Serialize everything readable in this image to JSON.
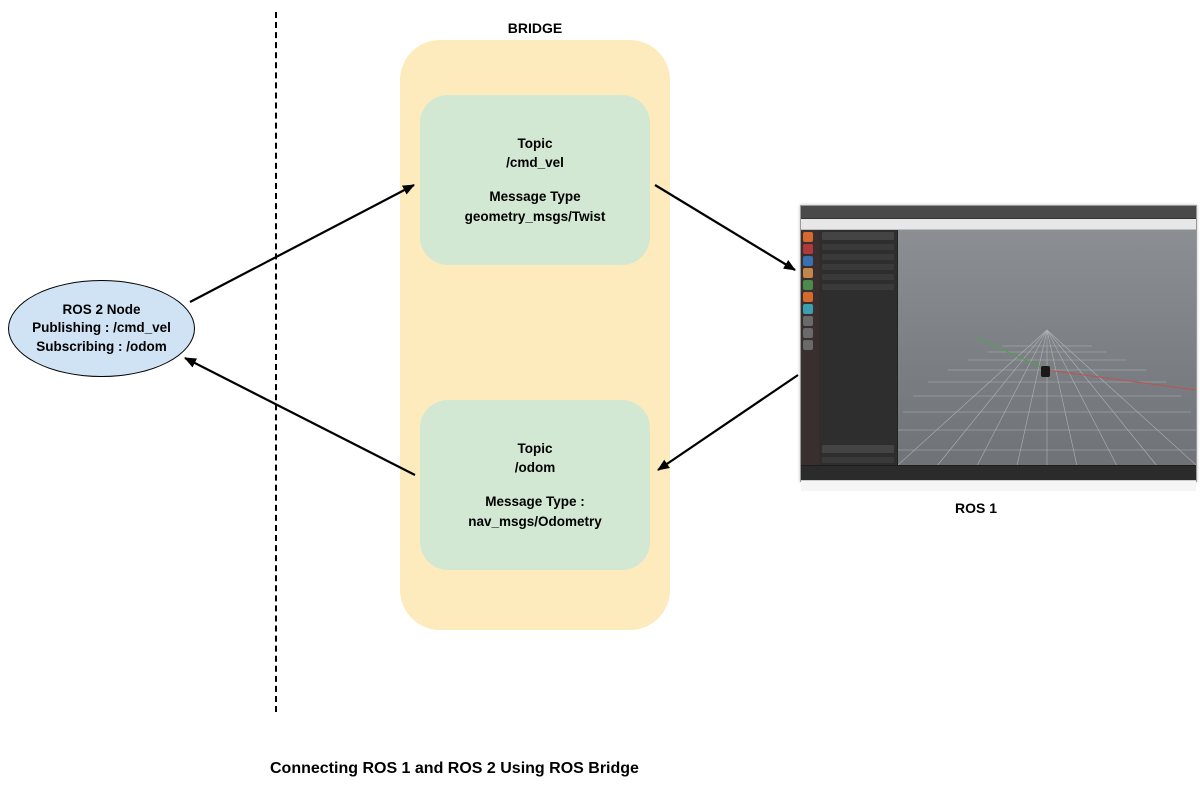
{
  "diagram": {
    "caption": "Connecting ROS 1 and ROS 2 Using ROS Bridge",
    "ros2_node": {
      "title": "ROS 2 Node",
      "pub_line": "Publishing : /cmd_vel",
      "sub_line": "Subscribing : /odom"
    },
    "bridge": {
      "label": "BRIDGE",
      "topics": [
        {
          "title": "Topic",
          "name": "/cmd_vel",
          "msg_label": "Message Type",
          "msg_type": "geometry_msgs/Twist"
        },
        {
          "title": "Topic",
          "name": "/odom",
          "msg_label": "Message Type :",
          "msg_type": "nav_msgs/Odometry"
        }
      ]
    },
    "ros1": {
      "label": "ROS 1"
    },
    "edges": [
      {
        "from": "ros2_node",
        "to": "bridge.topic.cmd_vel",
        "direction": "forward"
      },
      {
        "from": "bridge.topic.cmd_vel",
        "to": "ros1",
        "direction": "forward"
      },
      {
        "from": "ros1",
        "to": "bridge.topic.odom",
        "direction": "forward"
      },
      {
        "from": "bridge.topic.odom",
        "to": "ros2_node",
        "direction": "forward"
      }
    ]
  }
}
